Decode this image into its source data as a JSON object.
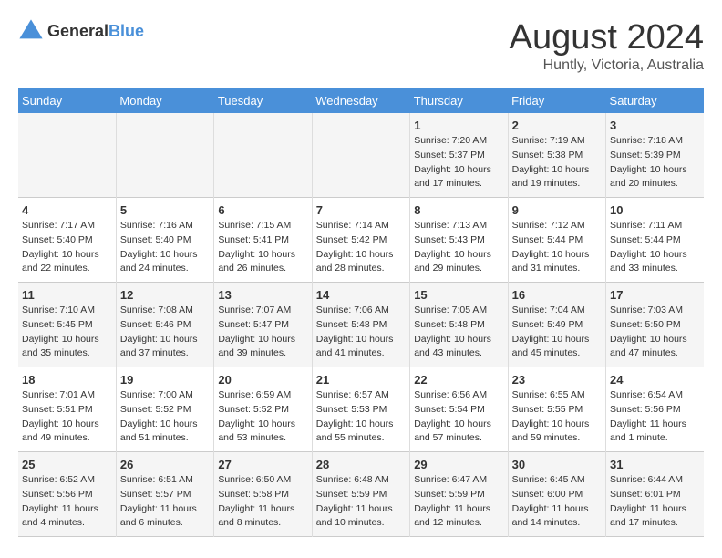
{
  "header": {
    "logo_general": "General",
    "logo_blue": "Blue",
    "month_year": "August 2024",
    "location": "Huntly, Victoria, Australia"
  },
  "days_of_week": [
    "Sunday",
    "Monday",
    "Tuesday",
    "Wednesday",
    "Thursday",
    "Friday",
    "Saturday"
  ],
  "weeks": [
    [
      {
        "day": "",
        "info": ""
      },
      {
        "day": "",
        "info": ""
      },
      {
        "day": "",
        "info": ""
      },
      {
        "day": "",
        "info": ""
      },
      {
        "day": "1",
        "info": "Sunrise: 7:20 AM\nSunset: 5:37 PM\nDaylight: 10 hours\nand 17 minutes."
      },
      {
        "day": "2",
        "info": "Sunrise: 7:19 AM\nSunset: 5:38 PM\nDaylight: 10 hours\nand 19 minutes."
      },
      {
        "day": "3",
        "info": "Sunrise: 7:18 AM\nSunset: 5:39 PM\nDaylight: 10 hours\nand 20 minutes."
      }
    ],
    [
      {
        "day": "4",
        "info": "Sunrise: 7:17 AM\nSunset: 5:40 PM\nDaylight: 10 hours\nand 22 minutes."
      },
      {
        "day": "5",
        "info": "Sunrise: 7:16 AM\nSunset: 5:40 PM\nDaylight: 10 hours\nand 24 minutes."
      },
      {
        "day": "6",
        "info": "Sunrise: 7:15 AM\nSunset: 5:41 PM\nDaylight: 10 hours\nand 26 minutes."
      },
      {
        "day": "7",
        "info": "Sunrise: 7:14 AM\nSunset: 5:42 PM\nDaylight: 10 hours\nand 28 minutes."
      },
      {
        "day": "8",
        "info": "Sunrise: 7:13 AM\nSunset: 5:43 PM\nDaylight: 10 hours\nand 29 minutes."
      },
      {
        "day": "9",
        "info": "Sunrise: 7:12 AM\nSunset: 5:44 PM\nDaylight: 10 hours\nand 31 minutes."
      },
      {
        "day": "10",
        "info": "Sunrise: 7:11 AM\nSunset: 5:44 PM\nDaylight: 10 hours\nand 33 minutes."
      }
    ],
    [
      {
        "day": "11",
        "info": "Sunrise: 7:10 AM\nSunset: 5:45 PM\nDaylight: 10 hours\nand 35 minutes."
      },
      {
        "day": "12",
        "info": "Sunrise: 7:08 AM\nSunset: 5:46 PM\nDaylight: 10 hours\nand 37 minutes."
      },
      {
        "day": "13",
        "info": "Sunrise: 7:07 AM\nSunset: 5:47 PM\nDaylight: 10 hours\nand 39 minutes."
      },
      {
        "day": "14",
        "info": "Sunrise: 7:06 AM\nSunset: 5:48 PM\nDaylight: 10 hours\nand 41 minutes."
      },
      {
        "day": "15",
        "info": "Sunrise: 7:05 AM\nSunset: 5:48 PM\nDaylight: 10 hours\nand 43 minutes."
      },
      {
        "day": "16",
        "info": "Sunrise: 7:04 AM\nSunset: 5:49 PM\nDaylight: 10 hours\nand 45 minutes."
      },
      {
        "day": "17",
        "info": "Sunrise: 7:03 AM\nSunset: 5:50 PM\nDaylight: 10 hours\nand 47 minutes."
      }
    ],
    [
      {
        "day": "18",
        "info": "Sunrise: 7:01 AM\nSunset: 5:51 PM\nDaylight: 10 hours\nand 49 minutes."
      },
      {
        "day": "19",
        "info": "Sunrise: 7:00 AM\nSunset: 5:52 PM\nDaylight: 10 hours\nand 51 minutes."
      },
      {
        "day": "20",
        "info": "Sunrise: 6:59 AM\nSunset: 5:52 PM\nDaylight: 10 hours\nand 53 minutes."
      },
      {
        "day": "21",
        "info": "Sunrise: 6:57 AM\nSunset: 5:53 PM\nDaylight: 10 hours\nand 55 minutes."
      },
      {
        "day": "22",
        "info": "Sunrise: 6:56 AM\nSunset: 5:54 PM\nDaylight: 10 hours\nand 57 minutes."
      },
      {
        "day": "23",
        "info": "Sunrise: 6:55 AM\nSunset: 5:55 PM\nDaylight: 10 hours\nand 59 minutes."
      },
      {
        "day": "24",
        "info": "Sunrise: 6:54 AM\nSunset: 5:56 PM\nDaylight: 11 hours\nand 1 minute."
      }
    ],
    [
      {
        "day": "25",
        "info": "Sunrise: 6:52 AM\nSunset: 5:56 PM\nDaylight: 11 hours\nand 4 minutes."
      },
      {
        "day": "26",
        "info": "Sunrise: 6:51 AM\nSunset: 5:57 PM\nDaylight: 11 hours\nand 6 minutes."
      },
      {
        "day": "27",
        "info": "Sunrise: 6:50 AM\nSunset: 5:58 PM\nDaylight: 11 hours\nand 8 minutes."
      },
      {
        "day": "28",
        "info": "Sunrise: 6:48 AM\nSunset: 5:59 PM\nDaylight: 11 hours\nand 10 minutes."
      },
      {
        "day": "29",
        "info": "Sunrise: 6:47 AM\nSunset: 5:59 PM\nDaylight: 11 hours\nand 12 minutes."
      },
      {
        "day": "30",
        "info": "Sunrise: 6:45 AM\nSunset: 6:00 PM\nDaylight: 11 hours\nand 14 minutes."
      },
      {
        "day": "31",
        "info": "Sunrise: 6:44 AM\nSunset: 6:01 PM\nDaylight: 11 hours\nand 17 minutes."
      }
    ]
  ]
}
